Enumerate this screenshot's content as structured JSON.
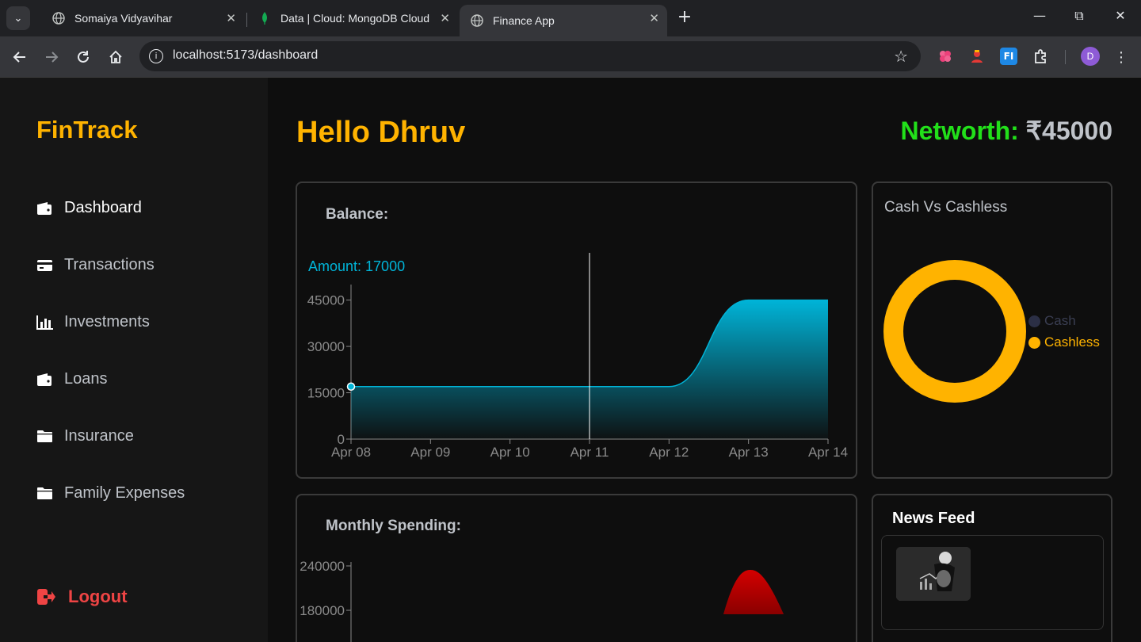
{
  "browser": {
    "tabs": [
      {
        "title": "Somaiya Vidyavihar",
        "icon": "globe-icon"
      },
      {
        "title": "Data | Cloud: MongoDB Cloud",
        "icon": "mongodb-leaf-icon"
      },
      {
        "title": "Finance App",
        "icon": "globe-icon",
        "active": true
      }
    ],
    "url": "localhost:5173/dashboard",
    "profile_initial": "D",
    "extensions": [
      "FI"
    ]
  },
  "sidebar": {
    "brand": "FinTrack",
    "items": [
      {
        "label": "Dashboard",
        "icon": "wallet-icon",
        "active": true
      },
      {
        "label": "Transactions",
        "icon": "credit-card-icon"
      },
      {
        "label": "Investments",
        "icon": "bar-chart-icon"
      },
      {
        "label": "Loans",
        "icon": "wallet-icon"
      },
      {
        "label": "Insurance",
        "icon": "folder-icon"
      },
      {
        "label": "Family Expenses",
        "icon": "folder-icon"
      }
    ],
    "logout": "Logout"
  },
  "header": {
    "greeting": "Hello Dhruv",
    "networth_label": "Networth:",
    "networth_value": "₹45000"
  },
  "balance_card": {
    "title": "Balance:",
    "tooltip": "Amount: 17000"
  },
  "cash_card": {
    "title": "Cash Vs Cashless",
    "legend": [
      {
        "label": "Cash",
        "color": "#2b2f45"
      },
      {
        "label": "Cashless",
        "color": "#ffb300"
      }
    ]
  },
  "spending_card": {
    "title": "Monthly Spending:"
  },
  "news_card": {
    "title": "News Feed"
  },
  "chart_data": [
    {
      "type": "area",
      "title": "Balance:",
      "x": [
        "Apr 08",
        "Apr 09",
        "Apr 10",
        "Apr 11",
        "Apr 12",
        "Apr 13",
        "Apr 14"
      ],
      "values": [
        17000,
        17000,
        17000,
        17000,
        17000,
        45000,
        45000
      ],
      "yticks": [
        0,
        15000,
        30000,
        45000
      ],
      "ylim": [
        0,
        49000
      ],
      "color": "#00b4d8",
      "hover": {
        "x": "Apr 11",
        "label": "Amount: 17000"
      },
      "grid": false
    },
    {
      "type": "pie",
      "title": "Cash Vs Cashless",
      "labels": [
        "Cash",
        "Cashless"
      ],
      "values": [
        0,
        100
      ],
      "colors": [
        "#2b2f45",
        "#ffb300"
      ],
      "legend": "right"
    },
    {
      "type": "area",
      "title": "Monthly Spending:",
      "yticks": [
        180000,
        240000
      ],
      "color": "#d40000"
    }
  ]
}
